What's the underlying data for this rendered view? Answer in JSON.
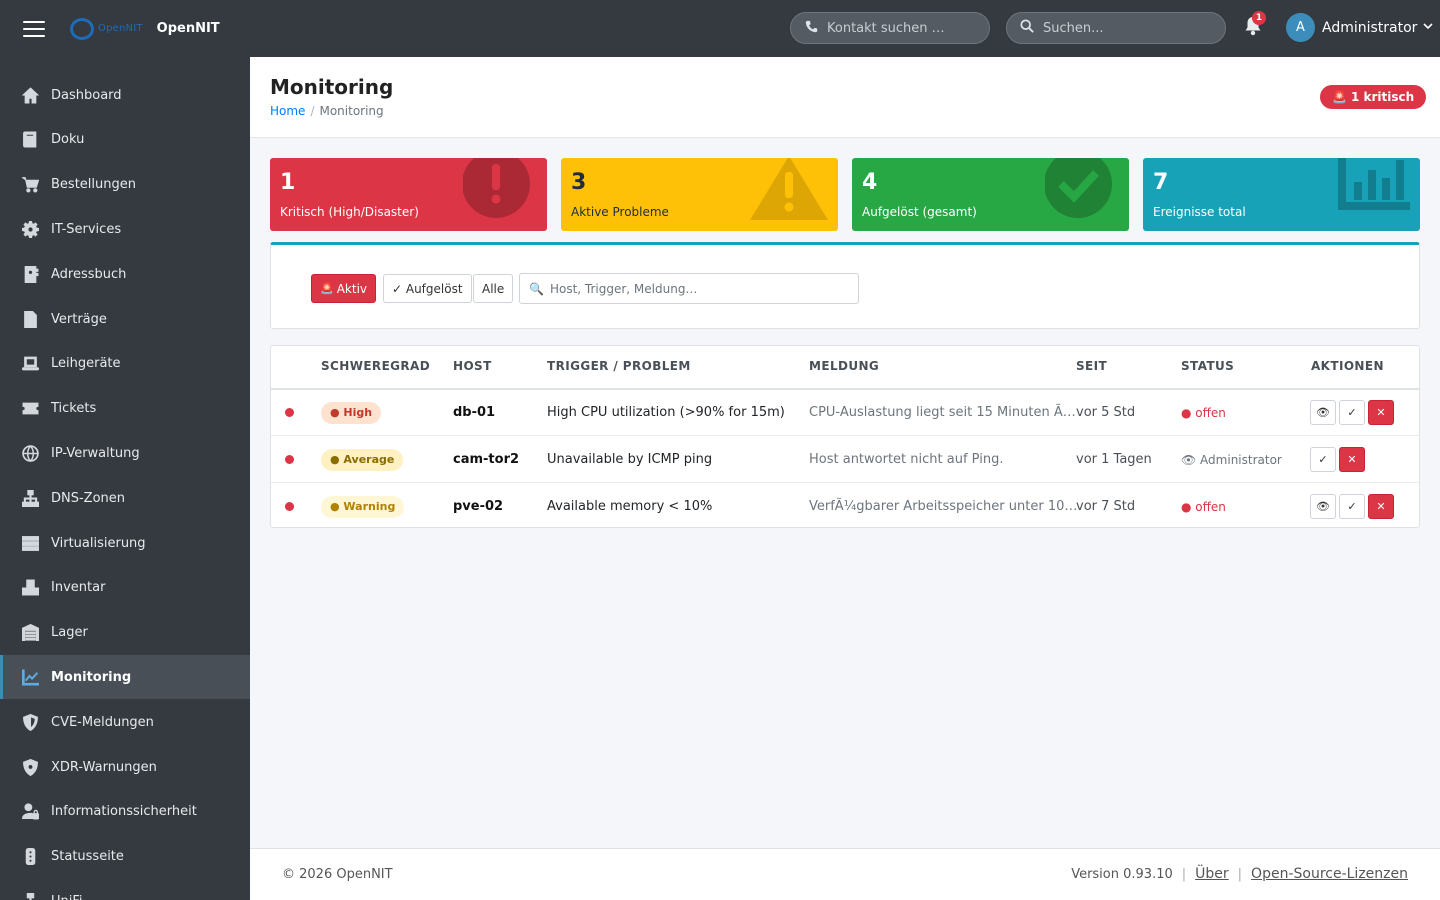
{
  "header": {
    "brand_logo_text": "OpenNIT",
    "brand_name": "OpenNIT",
    "contact_search_placeholder": "Kontakt suchen …",
    "global_search_placeholder": "Suchen...",
    "notification_count": "1",
    "user_initial": "A",
    "user_name": "Administrator"
  },
  "sidebar": {
    "items": [
      {
        "label": "Dashboard",
        "icon": "home-icon"
      },
      {
        "label": "Doku",
        "icon": "book-icon"
      },
      {
        "label": "Bestellungen",
        "icon": "cart-icon"
      },
      {
        "label": "IT-Services",
        "icon": "gear-icon"
      },
      {
        "label": "Adressbuch",
        "icon": "address-book-icon"
      },
      {
        "label": "Verträge",
        "icon": "contract-icon"
      },
      {
        "label": "Leihgeräte",
        "icon": "laptop-icon"
      },
      {
        "label": "Tickets",
        "icon": "ticket-icon"
      },
      {
        "label": "IP-Verwaltung",
        "icon": "globe-icon"
      },
      {
        "label": "DNS-Zonen",
        "icon": "sitemap-icon"
      },
      {
        "label": "Virtualisierung",
        "icon": "server-icon"
      },
      {
        "label": "Inventar",
        "icon": "boxes-icon"
      },
      {
        "label": "Lager",
        "icon": "warehouse-icon"
      },
      {
        "label": "Monitoring",
        "icon": "chart-line-icon",
        "active": true
      },
      {
        "label": "CVE-Meldungen",
        "icon": "shield-icon"
      },
      {
        "label": "XDR-Warnungen",
        "icon": "shield-virus-icon"
      },
      {
        "label": "Informationssicherheit",
        "icon": "user-lock-icon"
      },
      {
        "label": "Statusseite",
        "icon": "traffic-light-icon"
      },
      {
        "label": "UniFi",
        "icon": "network-icon"
      }
    ]
  },
  "page": {
    "title": "Monitoring",
    "breadcrumb_home": "Home",
    "breadcrumb_current": "Monitoring",
    "critical_pill": "1 kritisch"
  },
  "stats": [
    {
      "value": "1",
      "label": "Kritisch (High/Disaster)",
      "color": "#dc3545",
      "icon": "exclamation-circle-icon"
    },
    {
      "value": "3",
      "label": "Aktive Probleme",
      "color": "#ffc107",
      "icon": "warning-triangle-icon"
    },
    {
      "value": "4",
      "label": "Aufgelöst (gesamt)",
      "color": "#28a745",
      "icon": "check-circle-icon"
    },
    {
      "value": "7",
      "label": "Ereignisse total",
      "color": "#17a2b8",
      "icon": "bar-chart-icon"
    }
  ],
  "filters": {
    "active_label": "Aktiv",
    "resolved_label": "✓ Aufgelöst",
    "all_label": "Alle",
    "search_placeholder": "Host, Trigger, Meldung…"
  },
  "table": {
    "headers": [
      "SCHWEREGRAD",
      "HOST",
      "TRIGGER / PROBLEM",
      "MELDUNG",
      "SEIT",
      "STATUS",
      "AKTIONEN"
    ],
    "rows": [
      {
        "severity": "● High",
        "host": "db-01",
        "trigger": "High CPU utilization (>90% for 15m)",
        "message": "CPU-Auslastung liegt seit 15 Minuten Ã…",
        "since": "vor 5 Std",
        "status": "● offen"
      },
      {
        "severity": "● Average",
        "host": "cam-tor2",
        "trigger": "Unavailable by ICMP ping",
        "message": "Host antwortet nicht auf Ping.",
        "since": "vor 1 Tagen",
        "status": "👁 Administrator"
      },
      {
        "severity": "● Warning",
        "host": "pve-02",
        "trigger": "Available memory < 10%",
        "message": "VerfÃ¼gbarer Arbeitsspeicher unter 10…",
        "since": "vor 7 Std",
        "status": "● offen"
      }
    ]
  },
  "footer": {
    "copyright": "© 2026 OpenNIT",
    "version": "Version 0.93.10",
    "about": "Über",
    "licenses": "Open-Source-Lizenzen"
  }
}
